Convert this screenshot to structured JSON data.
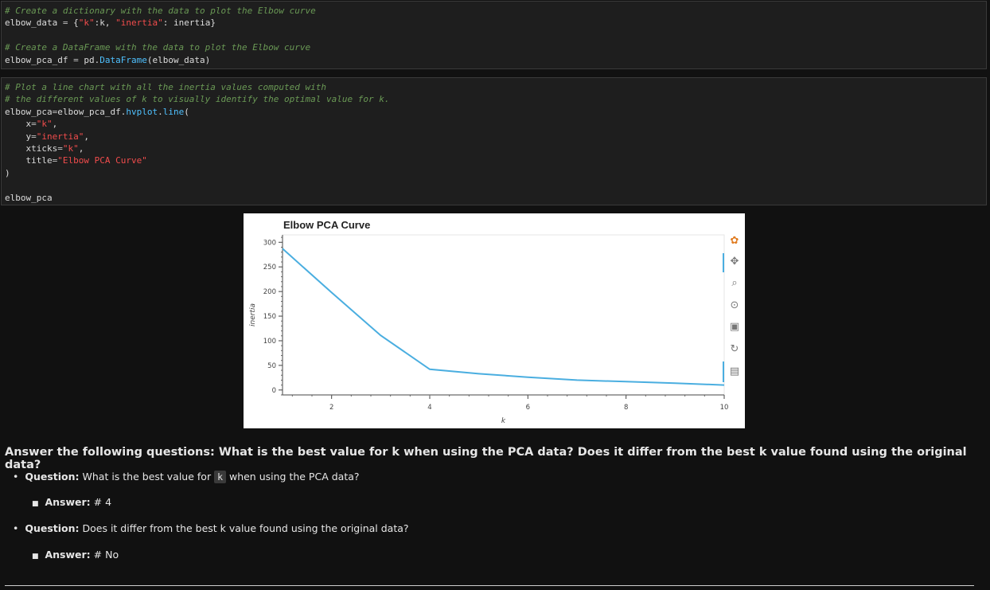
{
  "cell1": {
    "lines": [
      [
        {
          "t": "# Create a dictionary with the data to plot the Elbow curve",
          "c": "c-comment"
        }
      ],
      [
        {
          "t": "elbow_data ",
          "c": "c-kw"
        },
        {
          "t": "=",
          "c": "c-op"
        },
        {
          "t": " {",
          "c": "c-kw"
        },
        {
          "t": "\"k\"",
          "c": "c-str"
        },
        {
          "t": ":k, ",
          "c": "c-kw"
        },
        {
          "t": "\"inertia\"",
          "c": "c-str"
        },
        {
          "t": ": inertia}",
          "c": "c-kw"
        }
      ],
      [
        {
          "t": " ",
          "c": "c-kw"
        }
      ],
      [
        {
          "t": "# Create a DataFrame with the data to plot the Elbow curve",
          "c": "c-comment"
        }
      ],
      [
        {
          "t": "elbow_pca_df ",
          "c": "c-kw"
        },
        {
          "t": "=",
          "c": "c-op"
        },
        {
          "t": " pd.",
          "c": "c-kw"
        },
        {
          "t": "DataFrame",
          "c": "c-fn"
        },
        {
          "t": "(elbow_data)",
          "c": "c-kw"
        }
      ]
    ]
  },
  "cell2": {
    "lines": [
      [
        {
          "t": "# Plot a line chart with all the inertia values computed with",
          "c": "c-comment"
        }
      ],
      [
        {
          "t": "# the different values of k to visually identify the optimal value for k.",
          "c": "c-comment"
        }
      ],
      [
        {
          "t": "elbow_pca",
          "c": "c-kw"
        },
        {
          "t": "=",
          "c": "c-op"
        },
        {
          "t": "elbow_pca_df.",
          "c": "c-kw"
        },
        {
          "t": "hvplot",
          "c": "c-fn"
        },
        {
          "t": ".",
          "c": "c-kw"
        },
        {
          "t": "line",
          "c": "c-fn"
        },
        {
          "t": "(",
          "c": "c-kw"
        }
      ],
      [
        {
          "t": "    x",
          "c": "c-kw"
        },
        {
          "t": "=",
          "c": "c-op"
        },
        {
          "t": "\"k\"",
          "c": "c-str"
        },
        {
          "t": ",",
          "c": "c-kw"
        }
      ],
      [
        {
          "t": "    y",
          "c": "c-kw"
        },
        {
          "t": "=",
          "c": "c-op"
        },
        {
          "t": "\"inertia\"",
          "c": "c-str"
        },
        {
          "t": ",",
          "c": "c-kw"
        }
      ],
      [
        {
          "t": "    xticks",
          "c": "c-kw"
        },
        {
          "t": "=",
          "c": "c-op"
        },
        {
          "t": "\"k\"",
          "c": "c-str"
        },
        {
          "t": ",",
          "c": "c-kw"
        }
      ],
      [
        {
          "t": "    title",
          "c": "c-kw"
        },
        {
          "t": "=",
          "c": "c-op"
        },
        {
          "t": "\"Elbow PCA Curve\"",
          "c": "c-str"
        }
      ],
      [
        {
          "t": ")",
          "c": "c-kw"
        }
      ],
      [
        {
          "t": " ",
          "c": "c-kw"
        }
      ],
      [
        {
          "t": "elbow_pca",
          "c": "c-kw"
        }
      ]
    ]
  },
  "chart_data": {
    "type": "line",
    "title": "Elbow PCA Curve",
    "xlabel": "k",
    "ylabel": "inertia",
    "x": [
      1,
      2,
      3,
      4,
      5,
      6,
      7,
      8,
      9,
      10
    ],
    "series": [
      {
        "values": [
          287,
          198,
          111,
          42,
          33,
          26,
          20,
          17,
          14,
          10
        ]
      }
    ],
    "xlim": [
      1,
      10
    ],
    "ylim": [
      -10,
      315
    ],
    "xticks": [
      2,
      4,
      6,
      8,
      10
    ],
    "yticks": [
      0,
      50,
      100,
      150,
      200,
      250,
      300
    ],
    "grid": false,
    "line_color": "#4aaee0"
  },
  "toolbar": {
    "icons": [
      "bokeh-logo-icon",
      "pan-icon",
      "box-zoom-icon",
      "wheel-zoom-icon",
      "save-icon",
      "reset-icon",
      "hover-icon"
    ]
  },
  "markdown": {
    "heading": "Answer the following questions: What is the best value for k when using the PCA data? Does it differ from the best k value found using the original data?",
    "q1_label": "Question:",
    "q1_pre": " What is the best value for ",
    "q1_code": "k",
    "q1_post": " when using the PCA data?",
    "a1_label": "Answer:",
    "a1_text": " # 4",
    "q2_label": "Question:",
    "q2_text": " Does it differ from the best k value found using the original data?",
    "a2_label": "Answer:",
    "a2_text": " # No"
  }
}
